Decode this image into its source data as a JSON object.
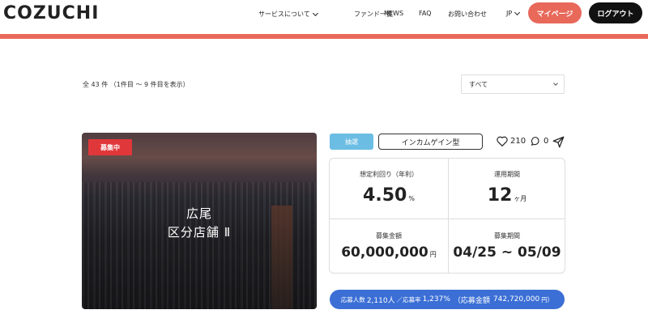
{
  "header": {
    "logo": "COZUCHI",
    "nav": {
      "services": "サービスについて",
      "fund_list": "ファンド一覧",
      "news": "NEWS",
      "faq": "FAQ",
      "contact": "お問い合わせ",
      "lang": "JP"
    },
    "mypage_label": "マイページ",
    "logout_label": "ログアウト"
  },
  "listing": {
    "count_text": "全 43 件 （1件目 〜 9 件目を表示）",
    "filter_value": "すべて"
  },
  "card": {
    "status_badge": "募集中",
    "title_line1": "広尾",
    "title_line2": "区分店舗 Ⅱ",
    "tag_lottery": "抽選",
    "tag_type": "インカムゲイン型",
    "likes": "210",
    "comments": "0",
    "yield_label": "想定利回り（年利）",
    "yield_value": "4.50",
    "yield_unit": "%",
    "period_label": "運用期間",
    "period_value": "12",
    "period_unit": "ヶ月",
    "amount_label": "募集金額",
    "amount_value": "60,000,000",
    "amount_unit": "円",
    "recruit_period_label": "募集期間",
    "recruit_period_value": "04/25 ~ 05/09",
    "summary_prefix": "応募人数",
    "summary_applicants": "2,110人",
    "summary_sep": "／応募率",
    "summary_rate": "1,237%",
    "summary_amount_label": "（応募金額",
    "summary_amount": "742,720,000",
    "summary_amount_unit": "円）"
  },
  "colors": {
    "accent": "#e8685a",
    "recruit_badge": "#e0373b",
    "lottery_tag": "#6bbde3",
    "summary_bar": "#3b6fd6"
  },
  "icons": [
    "chevron-down-icon",
    "heart-icon",
    "comment-icon",
    "share-icon"
  ]
}
